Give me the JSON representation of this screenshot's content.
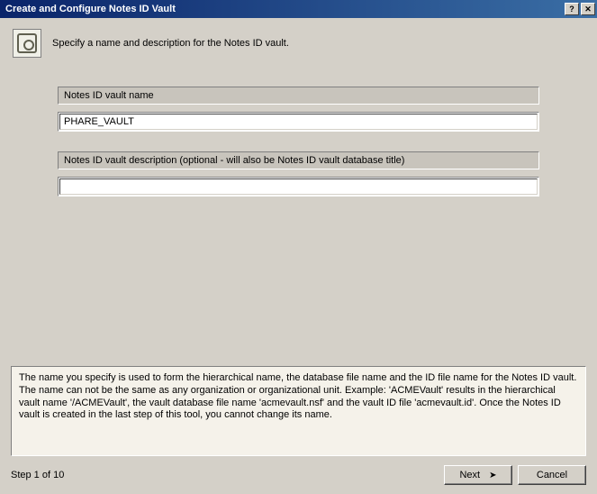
{
  "titlebar": {
    "title": "Create and Configure Notes ID Vault",
    "help": "?",
    "close": "✕"
  },
  "header": {
    "instruction": "Specify a name and description for the Notes ID vault."
  },
  "form": {
    "vault_name_label": "Notes ID vault name",
    "vault_name_value": "PHARE_VAULT",
    "vault_desc_label": "Notes ID vault description (optional - will also be Notes ID vault database title)",
    "vault_desc_value": ""
  },
  "info": {
    "text": "The name you specify is used to form the hierarchical name, the database file name and the ID file name for the Notes ID vault.  The name can not be the same as any organization or organizational unit.  Example: 'ACMEVault' results in the hierarchical vault name '/ACMEVault', the vault database file name 'acmevault.nsf' and the vault ID file 'acmevault.id'.  Once the Notes ID vault is created in the last step of this tool, you cannot change its name."
  },
  "footer": {
    "step": "Step 1 of 10",
    "next": "Next",
    "cancel": "Cancel"
  }
}
